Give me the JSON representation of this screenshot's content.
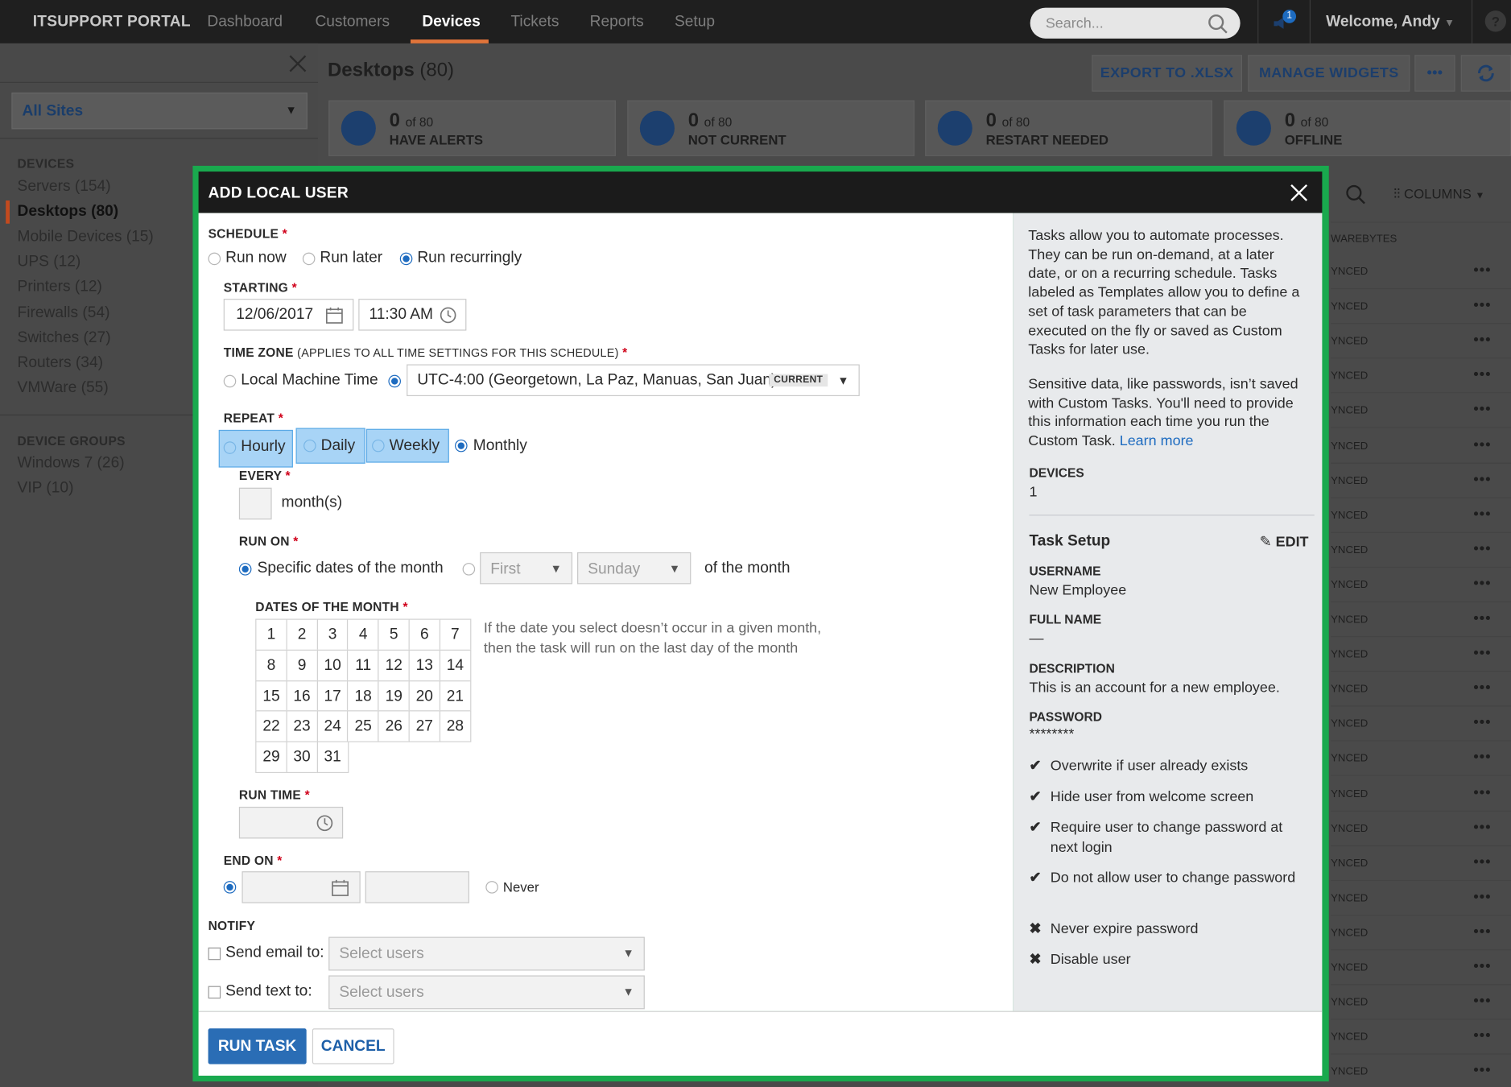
{
  "topbar": {
    "brand": "ITSUPPORT PORTAL",
    "nav": [
      "Dashboard",
      "Customers",
      "Devices",
      "Tickets",
      "Reports",
      "Setup"
    ],
    "active_nav": "Devices",
    "search_placeholder": "Search...",
    "notification_count": "1",
    "welcome": "Welcome, Andy"
  },
  "sidebar": {
    "site_select": "All Sites",
    "devices_heading": "DEVICES",
    "devices": [
      "Servers (154)",
      "Desktops (80)",
      "Mobile Devices (15)",
      "UPS (12)",
      "Printers (12)",
      "Firewalls (54)",
      "Switches (27)",
      "Routers (34)",
      "VMWare (55)"
    ],
    "groups_heading": "DEVICE GROUPS",
    "groups": [
      "Windows 7 (26)",
      "VIP (10)"
    ]
  },
  "page": {
    "title": "Desktops",
    "count": "(80)",
    "export_label": "EXPORT TO .XLSX",
    "widgets_label": "MANAGE WIDGETS",
    "more_label": "•••",
    "stats": [
      {
        "num": "0",
        "of": "of 80",
        "label": "HAVE ALERTS"
      },
      {
        "num": "0",
        "of": "of 80",
        "label": "NOT CURRENT"
      },
      {
        "num": "0",
        "of": "of 80",
        "label": "RESTART NEEDED"
      },
      {
        "num": "0",
        "of": "of 80",
        "label": "OFFLINE"
      }
    ],
    "columns_label": "COLUMNS",
    "column_header": "WAREBYTES",
    "row_status": "YNCED",
    "row_menu": "•••",
    "row_count": 24
  },
  "modal": {
    "title": "ADD LOCAL USER",
    "schedule_label": "SCHEDULE",
    "schedule_options": [
      "Run now",
      "Run later",
      "Run recurringly"
    ],
    "schedule_selected": "Run recurringly",
    "starting_label": "STARTING",
    "start_date": "12/06/2017",
    "start_time": "11:30 AM",
    "timezone_label": "TIME ZONE",
    "timezone_note": "(APPLIES TO ALL TIME SETTINGS FOR THIS SCHEDULE)",
    "local_machine_time": "Local Machine Time",
    "timezone_value": "UTC-4:00 (Georgetown, La Paz, Manuas, San Juan)",
    "timezone_badge": "CURRENT",
    "repeat_label": "REPEAT",
    "repeat_options": [
      "Hourly",
      "Daily",
      "Weekly",
      "Monthly"
    ],
    "repeat_selected": "Monthly",
    "every_label": "EVERY",
    "every_value": "",
    "every_unit": "month(s)",
    "run_on_label": "RUN ON",
    "run_on_specific": "Specific dates of the month",
    "run_on_ordinal": "First",
    "run_on_weekday": "Sunday",
    "run_on_suffix": "of the month",
    "dates_label": "DATES OF THE MONTH",
    "dates": [
      "1",
      "2",
      "3",
      "4",
      "5",
      "6",
      "7",
      "8",
      "9",
      "10",
      "11",
      "12",
      "13",
      "14",
      "15",
      "16",
      "17",
      "18",
      "19",
      "20",
      "21",
      "22",
      "23",
      "24",
      "25",
      "26",
      "27",
      "28",
      "29",
      "30",
      "31"
    ],
    "dates_note_1": "If the date you select doesn’t occur in a given month,",
    "dates_note_2": "then the task will run on the last day of the month",
    "run_time_label": "RUN TIME",
    "run_time_value": "",
    "end_on_label": "END ON",
    "end_never": "Never",
    "notify_label": "NOTIFY",
    "send_email": "Send email to:",
    "send_text": "Send text to:",
    "select_users_placeholder": "Select users",
    "run_task": "RUN TASK",
    "cancel": "CANCEL"
  },
  "info": {
    "para1": "Tasks allow you to automate processes. They can be run on-demand, at a later date, or on a recurring schedule. Tasks labeled as Templates allow you to define a set of task parameters that can be executed on the fly or saved as Custom Tasks for later use.",
    "para2": "Sensitive data, like passwords, isn’t saved with Custom Tasks. You'll need to provide this information each time you run the Custom Task.",
    "learn_more": "Learn more",
    "devices_label": "DEVICES",
    "devices_value": "1",
    "task_setup": "Task Setup",
    "edit": "EDIT",
    "username_label": "USERNAME",
    "username_value": "New Employee",
    "fullname_label": "FULL NAME",
    "fullname_value": "—",
    "description_label": "DESCRIPTION",
    "description_value": "This is an account for a new employee.",
    "password_label": "PASSWORD",
    "password_value": "********",
    "options": [
      {
        "mark": "✔",
        "text": "Overwrite if user already exists"
      },
      {
        "mark": "✔",
        "text": "Hide user from welcome screen"
      },
      {
        "mark": "✔",
        "text": "Require user to change password at next login"
      },
      {
        "mark": "✔",
        "text": "Do not allow user to change password"
      },
      {
        "mark": "✖",
        "text": "Never expire password"
      },
      {
        "mark": "✖",
        "text": "Disable user"
      }
    ]
  },
  "colors": {
    "accent": "#1d6bc0",
    "modal_border": "#19a94e",
    "nav_active_underline": "#e0743a",
    "required": "#d0021b"
  }
}
